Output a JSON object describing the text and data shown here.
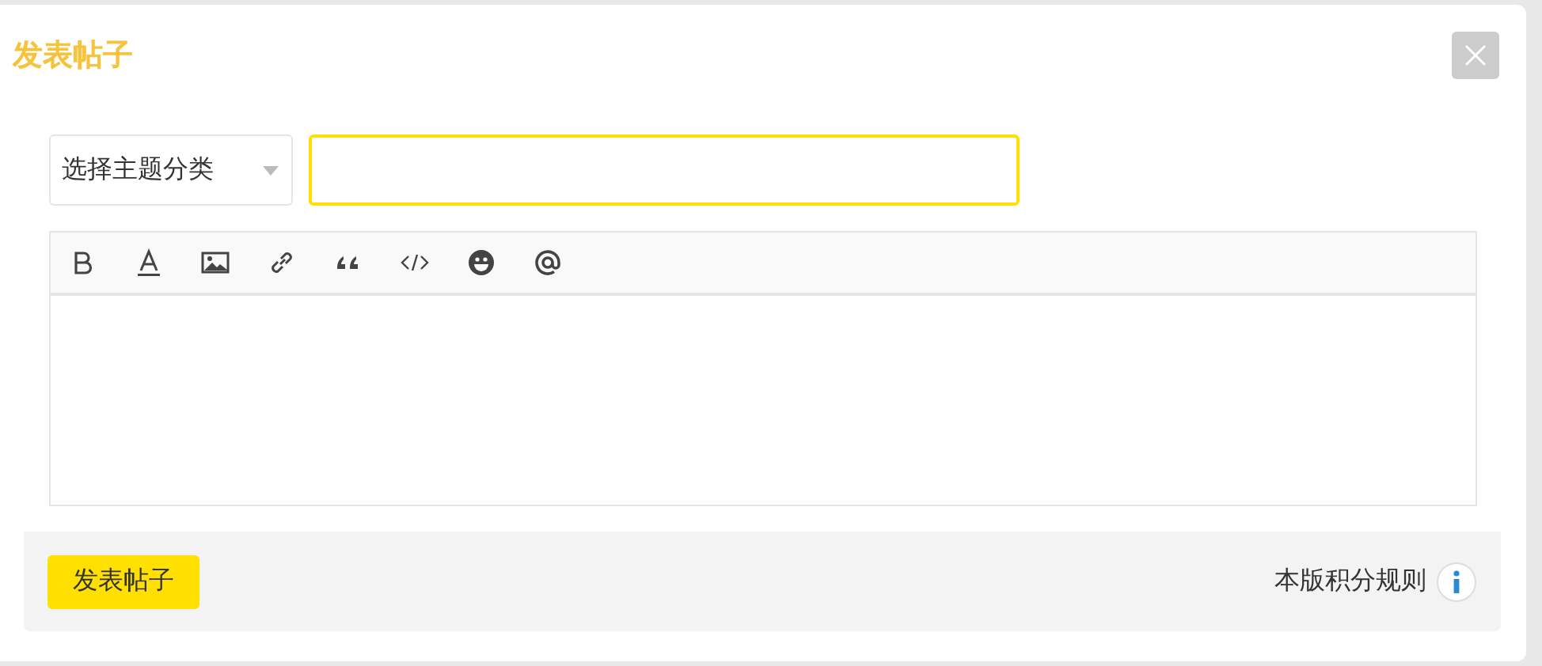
{
  "dialog": {
    "title": "发表帖子"
  },
  "category_select": {
    "value": "选择主题分类"
  },
  "editor_toolbar": {
    "tools": [
      {
        "kind": "bold"
      },
      {
        "kind": "color"
      },
      {
        "kind": "image"
      },
      {
        "kind": "link"
      },
      {
        "kind": "quote"
      },
      {
        "kind": "code"
      },
      {
        "kind": "emoji"
      },
      {
        "kind": "mention"
      }
    ]
  },
  "footer": {
    "submit_button": "发表帖子",
    "rules_link": "本版积分规则"
  }
}
